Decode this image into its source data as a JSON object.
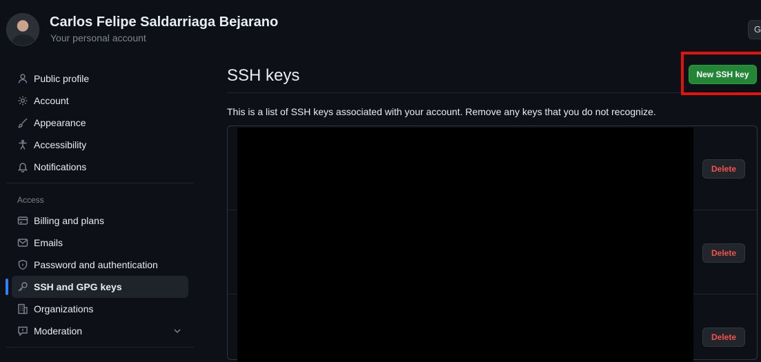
{
  "header": {
    "user_name": "Carlos Felipe Saldarriaga Bejarano",
    "user_subtitle": "Your personal account",
    "go_button_label": "G"
  },
  "sidebar": {
    "items": [
      {
        "label": "Public profile",
        "icon": "person-icon"
      },
      {
        "label": "Account",
        "icon": "gear-icon"
      },
      {
        "label": "Appearance",
        "icon": "paintbrush-icon"
      },
      {
        "label": "Accessibility",
        "icon": "accessibility-icon"
      },
      {
        "label": "Notifications",
        "icon": "bell-icon"
      }
    ],
    "section_title": "Access",
    "access_items": [
      {
        "label": "Billing and plans",
        "icon": "credit-card-icon"
      },
      {
        "label": "Emails",
        "icon": "mail-icon"
      },
      {
        "label": "Password and authentication",
        "icon": "shield-lock-icon"
      },
      {
        "label": "SSH and GPG keys",
        "icon": "key-icon",
        "active": true
      },
      {
        "label": "Organizations",
        "icon": "organization-icon"
      },
      {
        "label": "Moderation",
        "icon": "report-icon"
      }
    ]
  },
  "main": {
    "title": "SSH keys",
    "new_key_label": "New SSH key",
    "description": "This is a list of SSH keys associated with your account. Remove any keys that you do not recognize.",
    "keys": [
      {
        "delete_label": "Delete"
      },
      {
        "delete_label": "Delete"
      },
      {
        "delete_label": "Delete"
      }
    ]
  },
  "colors": {
    "background": "#0d1117",
    "primary_button": "#238636",
    "danger_text": "#f85149",
    "highlight": "#e3120b",
    "active_indicator": "#2f81f7"
  }
}
